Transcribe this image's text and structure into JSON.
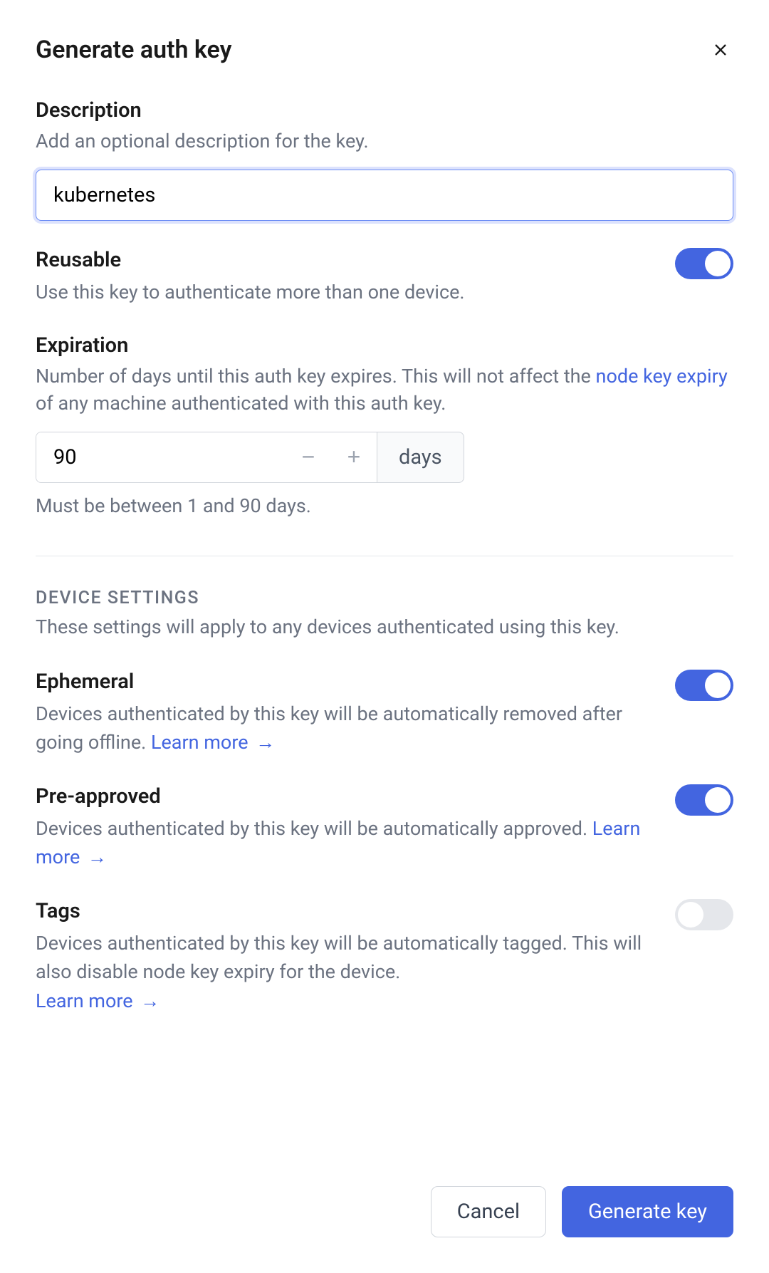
{
  "dialog": {
    "title": "Generate auth key"
  },
  "description": {
    "label": "Description",
    "hint": "Add an optional description for the key.",
    "value": "kubernetes"
  },
  "reusable": {
    "label": "Reusable",
    "hint": "Use this key to authenticate more than one device.",
    "enabled": true
  },
  "expiration": {
    "label": "Expiration",
    "hint_pre": "Number of days until this auth key expires. This will not affect the ",
    "link_text": "node key expiry",
    "hint_post": " of any machine authenticated with this auth key.",
    "value": "90",
    "unit": "days",
    "constraint": "Must be between 1 and 90 days."
  },
  "device_settings": {
    "heading": "DEVICE SETTINGS",
    "desc": "These settings will apply to any devices authenticated using this key."
  },
  "ephemeral": {
    "label": "Ephemeral",
    "hint": "Devices authenticated by this key will be automatically removed after going offline. ",
    "learn_more": "Learn more",
    "enabled": true
  },
  "preapproved": {
    "label": "Pre-approved",
    "hint": "Devices authenticated by this key will be automatically approved. ",
    "learn_more": "Learn more",
    "enabled": true
  },
  "tags": {
    "label": "Tags",
    "hint": "Devices authenticated by this key will be automatically tagged. This will also disable node key expiry for the device. ",
    "learn_more": "Learn more",
    "enabled": false
  },
  "footer": {
    "cancel": "Cancel",
    "submit": "Generate key"
  }
}
